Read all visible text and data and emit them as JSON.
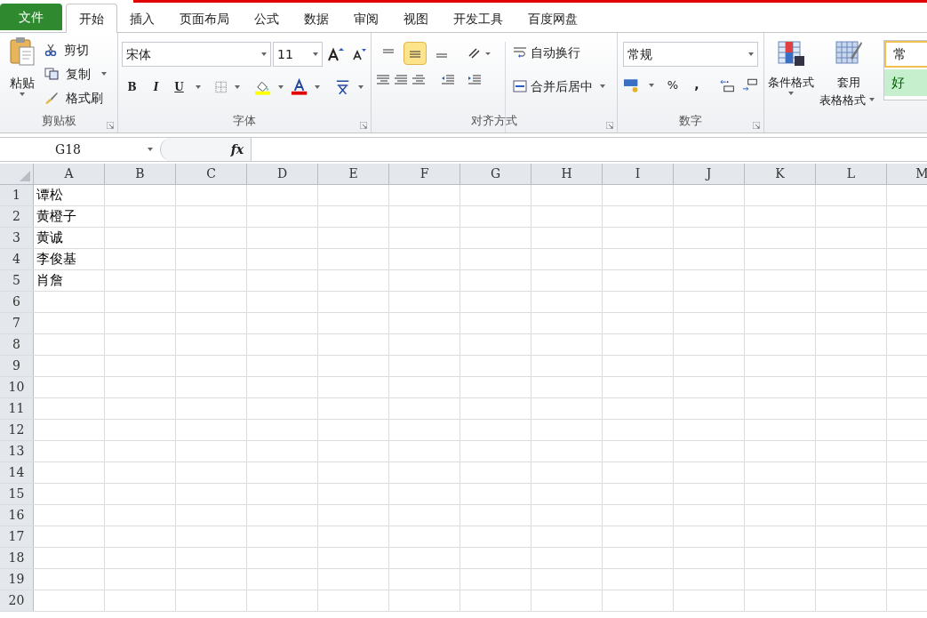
{
  "tabs": [
    {
      "label": "文件",
      "kind": "file",
      "selected": false
    },
    {
      "label": "开始",
      "kind": "tab",
      "selected": true
    },
    {
      "label": "插入",
      "kind": "tab",
      "selected": false
    },
    {
      "label": "页面布局",
      "kind": "tab",
      "selected": false
    },
    {
      "label": "公式",
      "kind": "tab",
      "selected": false
    },
    {
      "label": "数据",
      "kind": "tab",
      "selected": false
    },
    {
      "label": "审阅",
      "kind": "tab",
      "selected": false
    },
    {
      "label": "视图",
      "kind": "tab",
      "selected": false
    },
    {
      "label": "开发工具",
      "kind": "tab",
      "selected": false
    },
    {
      "label": "百度网盘",
      "kind": "tab",
      "selected": false
    }
  ],
  "clipboard": {
    "paste": "粘贴",
    "cut": "剪切",
    "copy": "复制",
    "painter": "格式刷",
    "label": "剪贴板"
  },
  "font": {
    "name": "宋体",
    "size": "11",
    "bold": "B",
    "italic": "I",
    "underline": "U",
    "label": "字体"
  },
  "alignment": {
    "align_buttons": [
      {
        "selected": false
      },
      {
        "selected": true
      },
      {
        "selected": false
      }
    ],
    "wrap": "自动换行",
    "merge": "合并后居中",
    "label": "对齐方式"
  },
  "number": {
    "format": "常规",
    "percent": "%",
    "comma": ",",
    "label": "数字"
  },
  "styles": {
    "conditional": "条件格式",
    "table_format_1": "套用",
    "table_format_2": "表格格式",
    "gallery": [
      "常",
      "好"
    ]
  },
  "formula_bar": {
    "name_box": "G18",
    "fx": "fx"
  },
  "sheet": {
    "columns": [
      "A",
      "B",
      "C",
      "D",
      "E",
      "F",
      "G",
      "H",
      "I",
      "J",
      "K",
      "L",
      "M"
    ],
    "rows": [
      {
        "number": "1",
        "cells": [
          "谭松"
        ]
      },
      {
        "number": "2",
        "cells": [
          "黄橙子"
        ]
      },
      {
        "number": "3",
        "cells": [
          "黄诚"
        ]
      },
      {
        "number": "4",
        "cells": [
          "李俊基"
        ]
      },
      {
        "number": "5",
        "cells": [
          "肖詹"
        ]
      },
      {
        "number": "6",
        "cells": []
      },
      {
        "number": "7",
        "cells": []
      },
      {
        "number": "8",
        "cells": []
      },
      {
        "number": "9",
        "cells": []
      },
      {
        "number": "10",
        "cells": []
      },
      {
        "number": "11",
        "cells": []
      },
      {
        "number": "12",
        "cells": []
      },
      {
        "number": "13",
        "cells": []
      },
      {
        "number": "14",
        "cells": []
      },
      {
        "number": "15",
        "cells": []
      },
      {
        "number": "16",
        "cells": []
      },
      {
        "number": "17",
        "cells": []
      },
      {
        "number": "18",
        "cells": []
      },
      {
        "number": "19",
        "cells": []
      },
      {
        "number": "20",
        "cells": []
      }
    ]
  }
}
